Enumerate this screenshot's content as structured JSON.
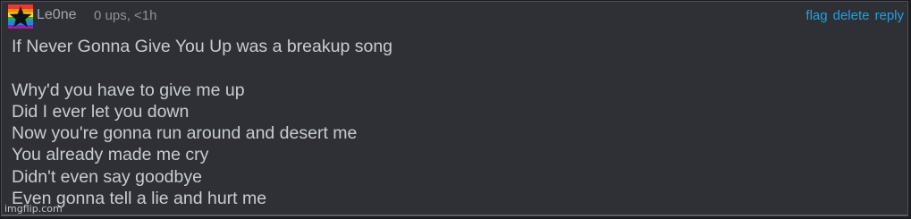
{
  "comment": {
    "username": "Le0ne",
    "meta": "0 ups, <1h",
    "actions": {
      "flag": "flag",
      "delete": "delete",
      "reply": "reply"
    },
    "lines": [
      "If Never Gonna Give You Up was a breakup song",
      "",
      "Why'd you have to give me up",
      "Did I ever let you down",
      "Now you're gonna run around and desert me",
      "You already made me cry",
      "Didn't even say goodbye",
      "Even gonna tell a lie and hurt me"
    ],
    "avatar_icon": "star-pride-flag-icon",
    "avatar_colors": [
      "#e53935",
      "#fb8c00",
      "#fdd835",
      "#43a047",
      "#1e88e5",
      "#8e24aa"
    ]
  },
  "watermark": "imgflip.com",
  "colors": {
    "background": "#2e3035",
    "link": "#1fa2e0",
    "text": "#c8ccd2"
  }
}
